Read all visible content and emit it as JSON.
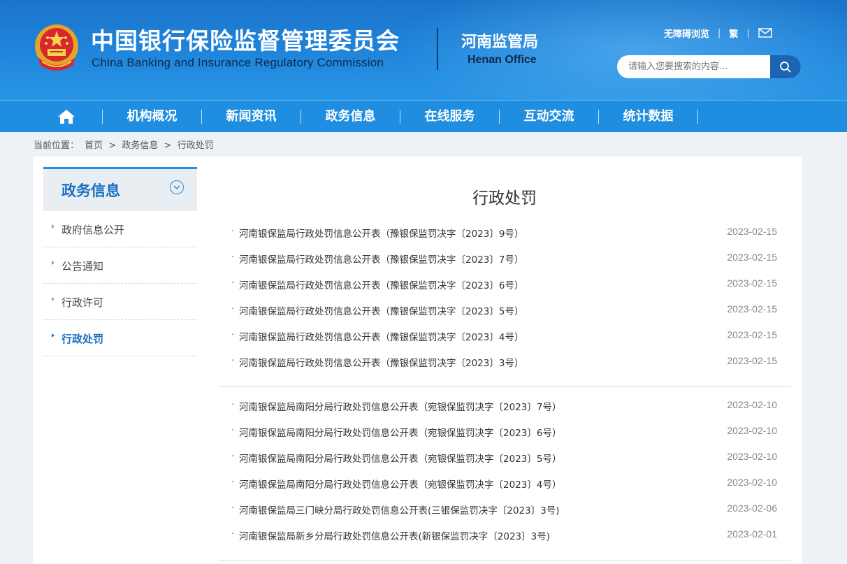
{
  "header": {
    "cn_title": "中国银行保险监督管理委员会",
    "en_title": "China Banking and Insurance Regulatory Commission",
    "office_cn": "河南监管局",
    "office_en": "Henan Office",
    "toplinks": {
      "accessible": "无障碍浏览",
      "traditional": "繁"
    },
    "search_placeholder": "请输入您要搜索的内容...",
    "colors": {
      "header_blue": "#1f86dc",
      "nav_blue": "#1f8ee1",
      "accent": "#1a6fc2"
    }
  },
  "nav": {
    "home_icon": "home-icon",
    "items": [
      "机构概况",
      "新闻资讯",
      "政务信息",
      "在线服务",
      "互动交流",
      "统计数据"
    ]
  },
  "breadcrumb": {
    "prefix": "当前位置：",
    "items": [
      "首页",
      "政务信息",
      "行政处罚"
    ],
    "sep": ">"
  },
  "sidebar": {
    "title": "政务信息",
    "items": [
      {
        "label": "政府信息公开"
      },
      {
        "label": "公告通知"
      },
      {
        "label": "行政许可"
      },
      {
        "label": "行政处罚"
      }
    ]
  },
  "main": {
    "title": "行政处罚",
    "group1": [
      {
        "text": "河南银保监局行政处罚信息公开表（豫银保监罚决字〔2023〕9号）",
        "date": "2023-02-15"
      },
      {
        "text": "河南银保监局行政处罚信息公开表（豫银保监罚决字〔2023〕7号）",
        "date": "2023-02-15"
      },
      {
        "text": "河南银保监局行政处罚信息公开表（豫银保监罚决字〔2023〕6号）",
        "date": "2023-02-15"
      },
      {
        "text": "河南银保监局行政处罚信息公开表（豫银保监罚决字〔2023〕5号）",
        "date": "2023-02-15"
      },
      {
        "text": "河南银保监局行政处罚信息公开表（豫银保监罚决字〔2023〕4号）",
        "date": "2023-02-15"
      },
      {
        "text": "河南银保监局行政处罚信息公开表（豫银保监罚决字〔2023〕3号）",
        "date": "2023-02-15"
      }
    ],
    "group2": [
      {
        "text": "河南银保监局南阳分局行政处罚信息公开表（宛银保监罚决字〔2023〕7号）",
        "date": "2023-02-10"
      },
      {
        "text": "河南银保监局南阳分局行政处罚信息公开表（宛银保监罚决字〔2023〕6号）",
        "date": "2023-02-10"
      },
      {
        "text": "河南银保监局南阳分局行政处罚信息公开表（宛银保监罚决字〔2023〕5号）",
        "date": "2023-02-10"
      },
      {
        "text": "河南银保监局南阳分局行政处罚信息公开表（宛银保监罚决字〔2023〕4号）",
        "date": "2023-02-10"
      },
      {
        "text": "河南银保监局三门峡分局行政处罚信息公开表(三银保监罚决字〔2023〕3号)",
        "date": "2023-02-06"
      },
      {
        "text": "河南银保监局新乡分局行政处罚信息公开表(新银保监罚决字〔2023〕3号)",
        "date": "2023-02-01"
      }
    ]
  }
}
